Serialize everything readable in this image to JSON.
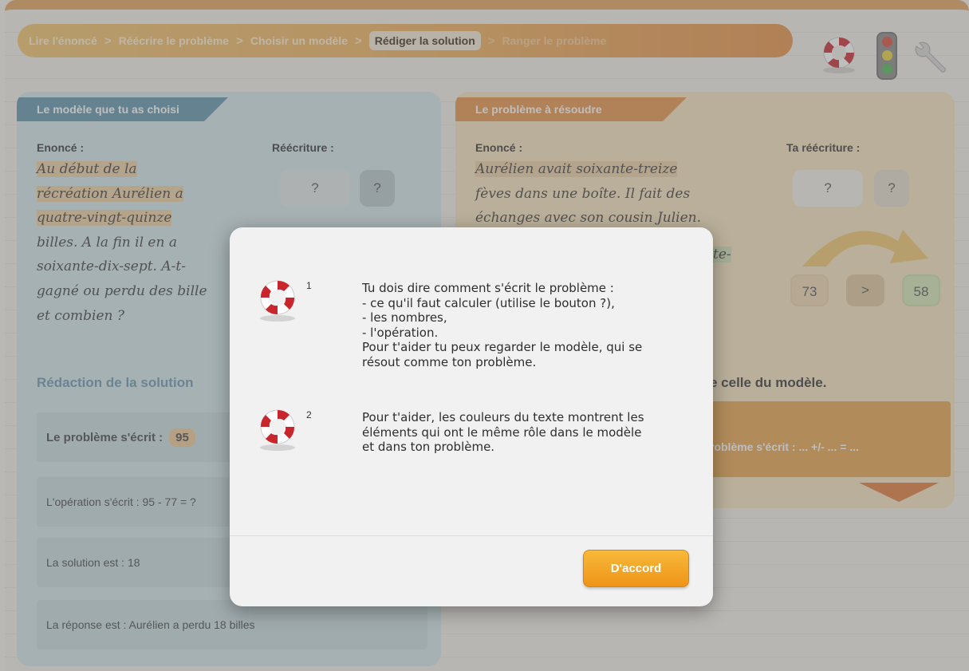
{
  "breadcrumb": [
    {
      "label": "Lire l'énoncé"
    },
    {
      "label": "Réécrire le problème"
    },
    {
      "label": "Choisir un modèle"
    },
    {
      "label": "Rédiger la solution"
    },
    {
      "label": "Ranger le problème"
    }
  ],
  "breadcrumb_separator": ">",
  "model_panel": {
    "tab": "Le modèle que tu as choisi",
    "statement_label": "Enoncé :",
    "statement_lines": [
      "Au début de la",
      "récréation Aurélien a",
      "quatre-vingt-quinze",
      "billes. A la fin il en a",
      "soixante-dix-sept. A-t-",
      "gagné ou perdu des bille",
      "et combien ?"
    ],
    "rewrite_label": "Réécriture :",
    "rewrite_values": [
      "?",
      "?"
    ],
    "solution_title": "Rédaction de la solution",
    "written_as_label": "Le problème s'écrit :",
    "written_as_value": "95",
    "operation": "L'opération s'écrit : 95 - 77 = ?",
    "solution": "La solution est : 18",
    "answer": "La réponse est : Aurélien a perdu 18 billes"
  },
  "problem_panel": {
    "tab": "Le problème à résoudre",
    "statement_label": "Enoncé :",
    "statement_lines": [
      "Aurélien avait soixante-treize",
      "fèves dans une boîte. Il fait des",
      "échanges avec son cousin Julien.",
      "te-"
    ],
    "rewrite_label": "Ta réécriture :",
    "rewrite_values": [
      "?",
      "?"
    ],
    "numbers": [
      "73",
      ">",
      "58"
    ],
    "hint": "e celle du modèle.",
    "written_as": "roblème s'écrit : ... +/- ... = ..."
  },
  "modal": {
    "items": [
      {
        "num": "1",
        "text": "Tu dois dire comment s'écrit le problème :\n- ce qu'il faut calculer (utilise le bouton ?),\n- les nombres,\n- l'opération.\nPour t'aider tu peux regarder le modèle, qui se\nrésout comme ton problème."
      },
      {
        "num": "2",
        "text": "Pour t'aider, les couleurs du texte montrent les\néléments qui ont le même rôle dans le modèle\net dans ton problème."
      }
    ],
    "ok_label": "D'accord"
  },
  "colors": {
    "accent_orange": "#ee9418",
    "model_blue": "#5d92ac",
    "problem_orange": "#e79046"
  },
  "icons": [
    "lifebuoy-icon",
    "traffic-light-icon",
    "wrench-icon"
  ]
}
